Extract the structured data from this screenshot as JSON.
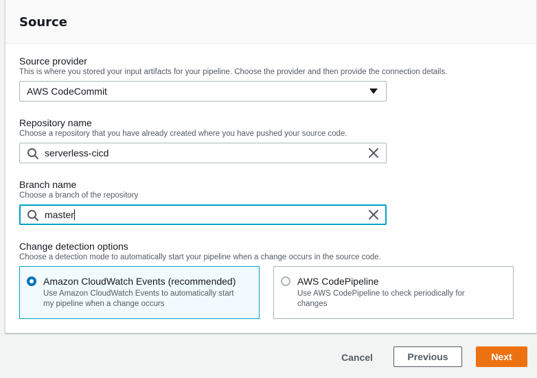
{
  "panel": {
    "title": "Source"
  },
  "source_provider": {
    "label": "Source provider",
    "description": "This is where you stored your input artifacts for your pipeline. Choose the provider and then provide the connection details.",
    "selected": "AWS CodeCommit"
  },
  "repository": {
    "label": "Repository name",
    "description": "Choose a repository that you have already created where you have pushed your source code.",
    "value": "serverless-cicd"
  },
  "branch": {
    "label": "Branch name",
    "description": "Choose a branch of the repository",
    "value": "master"
  },
  "change_detection": {
    "label": "Change detection options",
    "description": "Choose a detection mode to automatically start your pipeline when a change occurs in the source code.",
    "options": [
      {
        "title": "Amazon CloudWatch Events (recommended)",
        "description_line1": "Use Amazon CloudWatch Events to automatically start",
        "description_line2": "my pipeline when a change occurs",
        "checked": true
      },
      {
        "title": "AWS CodePipeline",
        "description_line1": "Use AWS CodePipeline to check periodically for",
        "description_line2": "changes",
        "checked": false
      }
    ]
  },
  "actions": {
    "cancel": "Cancel",
    "previous": "Previous",
    "next": "Next"
  },
  "colors": {
    "accent": "#00a1c9",
    "primary_button": "#ec7211",
    "radio_checked": "#0073bb"
  },
  "icons": {
    "search": "search-icon",
    "clear": "close-icon",
    "dropdown": "caret-down-icon"
  }
}
